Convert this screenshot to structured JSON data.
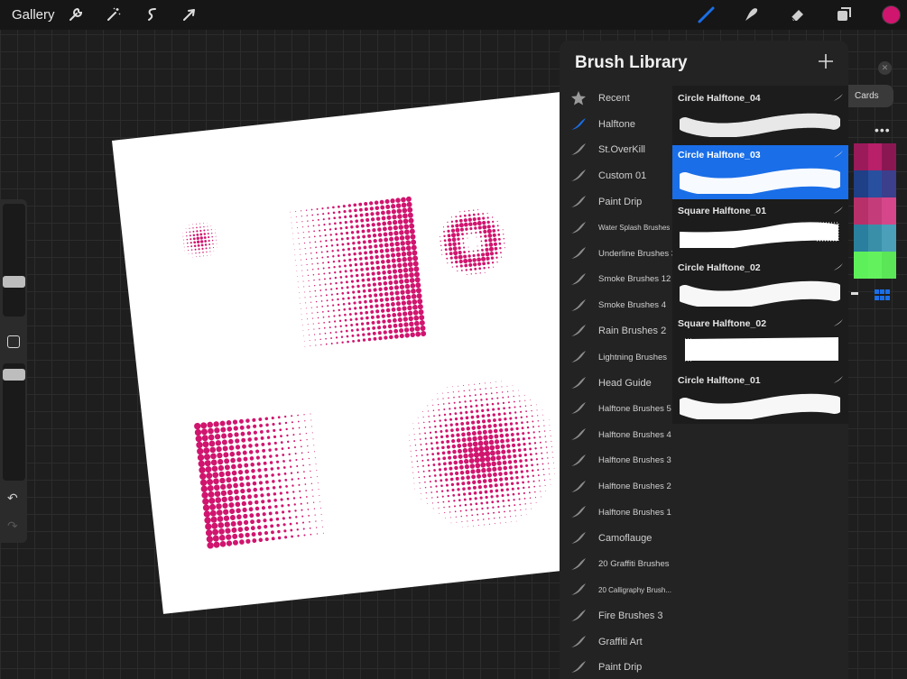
{
  "topbar": {
    "gallery_label": "Gallery",
    "left_icons": [
      "wrench-icon",
      "magic-wand-icon",
      "selection-s-icon",
      "arrow-cursor-icon"
    ],
    "right_icons": [
      "brush-icon",
      "smudge-icon",
      "eraser-icon",
      "layers-icon"
    ],
    "current_color": "#d0156f",
    "active_tool_color": "#1a6ee8"
  },
  "panel": {
    "title": "Brush Library",
    "categories": [
      {
        "label": "Recent",
        "icon": "star-icon",
        "size": "normal"
      },
      {
        "label": "Halftone",
        "icon": "brush-stroke-icon",
        "size": "normal",
        "active": true
      },
      {
        "label": "St.OverKill",
        "icon": "brush-stroke-icon",
        "size": "normal"
      },
      {
        "label": "Custom 01",
        "icon": "brush-stroke-icon",
        "size": "normal"
      },
      {
        "label": "Paint Drip",
        "icon": "brush-stroke-icon",
        "size": "normal"
      },
      {
        "label": "Water Splash Brushes",
        "icon": "brush-stroke-icon",
        "size": "tiny"
      },
      {
        "label": "Underline Brushes 3",
        "icon": "brush-stroke-icon",
        "size": "small"
      },
      {
        "label": "Smoke Brushes 12",
        "icon": "brush-stroke-icon",
        "size": "small"
      },
      {
        "label": "Smoke Brushes 4",
        "icon": "brush-stroke-icon",
        "size": "small"
      },
      {
        "label": "Rain Brushes 2",
        "icon": "brush-stroke-icon",
        "size": "normal"
      },
      {
        "label": "Lightning Brushes",
        "icon": "brush-stroke-icon",
        "size": "small"
      },
      {
        "label": "Head Guide",
        "icon": "brush-stroke-icon",
        "size": "normal"
      },
      {
        "label": "Halftone Brushes 5",
        "icon": "brush-stroke-icon",
        "size": "small"
      },
      {
        "label": "Halftone Brushes 4",
        "icon": "brush-stroke-icon",
        "size": "small"
      },
      {
        "label": "Halftone Brushes 3",
        "icon": "brush-stroke-icon",
        "size": "small"
      },
      {
        "label": "Halftone Brushes 2",
        "icon": "brush-stroke-icon",
        "size": "small"
      },
      {
        "label": "Halftone Brushes 1",
        "icon": "brush-stroke-icon",
        "size": "small"
      },
      {
        "label": "Camoflauge",
        "icon": "brush-stroke-icon",
        "size": "normal"
      },
      {
        "label": "20 Graffiti Brushes",
        "icon": "brush-stroke-icon",
        "size": "small"
      },
      {
        "label": "20 Calligraphy Brush...",
        "icon": "brush-stroke-icon",
        "size": "tiny"
      },
      {
        "label": "Fire Brushes 3",
        "icon": "brush-stroke-icon",
        "size": "normal"
      },
      {
        "label": "Graffiti Art",
        "icon": "brush-stroke-icon",
        "size": "normal"
      },
      {
        "label": "Paint Drip",
        "icon": "brush-stroke-icon",
        "size": "normal"
      }
    ],
    "brushes": [
      {
        "name": "Circle Halftone_04",
        "selected": false,
        "stroke": "dotted"
      },
      {
        "name": "Circle Halftone_03",
        "selected": true,
        "stroke": "smooth"
      },
      {
        "name": "Square Halftone_01",
        "selected": false,
        "stroke": "square"
      },
      {
        "name": "Circle Halftone_02",
        "selected": false,
        "stroke": "smooth"
      },
      {
        "name": "Square Halftone_02",
        "selected": false,
        "stroke": "square-flat"
      },
      {
        "name": "Circle Halftone_01",
        "selected": false,
        "stroke": "smooth"
      }
    ]
  },
  "right_panel": {
    "cards_label": "Cards",
    "palette": [
      [
        "#9b1a5a",
        "#b8206a",
        "#8a1752"
      ],
      [
        "#1f3f86",
        "#28509e",
        "#3b3f8c"
      ],
      [
        "#b8306a",
        "#c43c7a",
        "#d5478a"
      ],
      [
        "#2a7f9e",
        "#3a8fa8",
        "#4b9fb8"
      ],
      [
        "#5ef05a",
        "#63f25e",
        "#5ae656"
      ]
    ]
  },
  "artwork": {
    "ink_color": "#d0156f"
  }
}
